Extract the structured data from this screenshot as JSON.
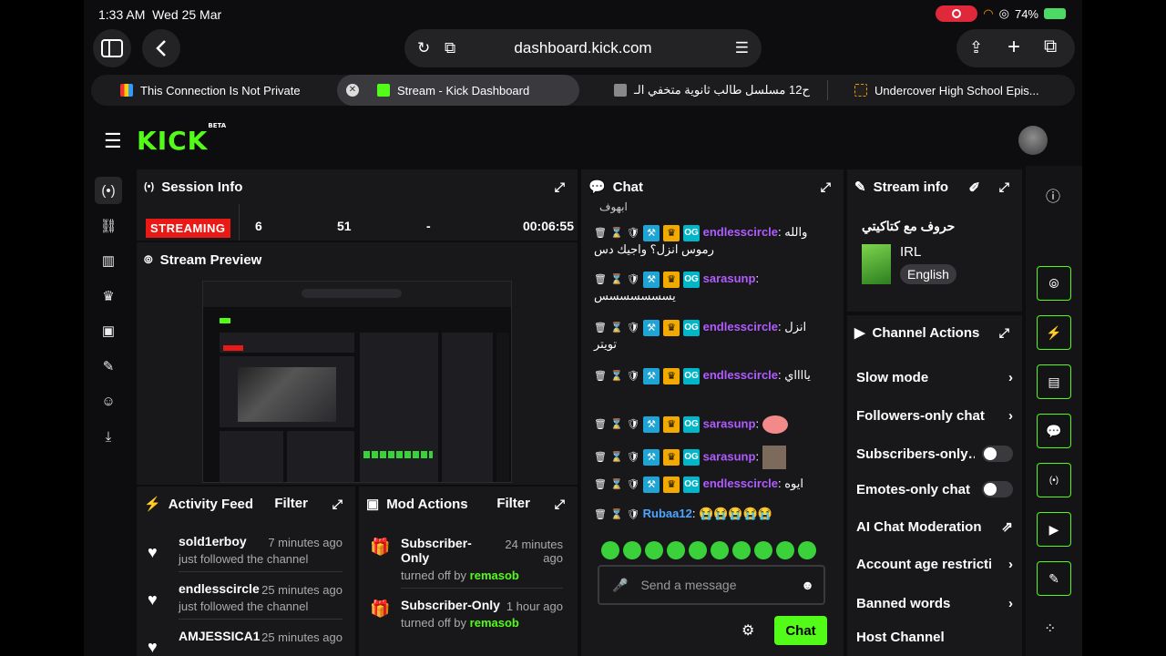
{
  "status_bar": {
    "time": "1:33 AM",
    "date": "Wed 25 Mar",
    "battery": "74%"
  },
  "browser": {
    "url": "dashboard.kick.com",
    "tabs": [
      {
        "label": "This Connection Is Not Private"
      },
      {
        "label": "Stream - Kick Dashboard"
      },
      {
        "label": "ح12 مسلسل طالب ثانوية متخفي الـ"
      },
      {
        "label": "Undercover High School Epis..."
      }
    ]
  },
  "header": {
    "logo": "KICK",
    "logo_badge": "BETA"
  },
  "session_info": {
    "title": "Session Info",
    "status": "STREAMING",
    "viewers": "6",
    "followers": "51",
    "subs": "-",
    "duration": "00:06:55"
  },
  "stream_preview": {
    "title": "Stream Preview"
  },
  "activity_feed": {
    "title": "Activity Feed",
    "filter": "Filter",
    "items": [
      {
        "user": "sold1erboy",
        "time": "7 minutes ago",
        "desc": "just followed the channel"
      },
      {
        "user": "endlesscircle",
        "time": "25 minutes ago",
        "desc": "just followed the channel"
      },
      {
        "user": "AMJESSICA1",
        "time": "25 minutes ago",
        "desc": ""
      }
    ]
  },
  "mod_actions": {
    "title": "Mod Actions",
    "filter": "Filter",
    "items": [
      {
        "action": "Subscriber-Only",
        "time": "24 minutes ago",
        "by": "turned off by",
        "mod": "remasob"
      },
      {
        "action": "Subscriber-Only",
        "time": "1 hour ago",
        "by": "turned off by",
        "mod": "remasob"
      }
    ]
  },
  "chat": {
    "title": "Chat",
    "partial_top": "ابهوف",
    "messages": [
      {
        "user": "endlesscircle",
        "text": "والله رموس انزل؟ واجيك دس",
        "color": "#b05cff"
      },
      {
        "user": "sarasunp",
        "text": "يسسسسسسس",
        "color": "#b05cff"
      },
      {
        "user": "endlesscircle",
        "text": "انزل تويتر",
        "color": "#b05cff"
      },
      {
        "user": "endlesscircle",
        "text": "يااااي",
        "color": "#b05cff"
      },
      {
        "user": "sarasunp",
        "text": "",
        "color": "#b05cff"
      },
      {
        "user": "sarasunp",
        "text": "",
        "color": "#b05cff"
      },
      {
        "user": "endlesscircle",
        "text": "ايوه",
        "color": "#b05cff"
      },
      {
        "user": "Rubaa12",
        "text": "😭😭😭😭😭",
        "color": "#4ea5ff"
      }
    ],
    "input_placeholder": "Send a message",
    "send_label": "Chat"
  },
  "stream_info": {
    "title": "Stream info",
    "stream_title": "حروف مع كتاكيتي",
    "category": "IRL",
    "language": "English"
  },
  "channel_actions": {
    "title": "Channel Actions",
    "items": [
      {
        "label": "Slow mode",
        "control": "chevron"
      },
      {
        "label": "Followers-only chat",
        "control": "chevron"
      },
      {
        "label": "Subscribers-only…",
        "control": "toggle"
      },
      {
        "label": "Emotes-only chat",
        "control": "toggle"
      },
      {
        "label": "AI Chat Moderation",
        "control": "external"
      },
      {
        "label": "Account age restrictio",
        "control": "chevron"
      },
      {
        "label": "Banned words",
        "control": "chevron"
      },
      {
        "label": "Host Channel",
        "control": "none"
      }
    ]
  },
  "colors": {
    "accent": "#53fc18",
    "live": "#e91916",
    "username": "#b05cff",
    "panel": "#18181b"
  }
}
